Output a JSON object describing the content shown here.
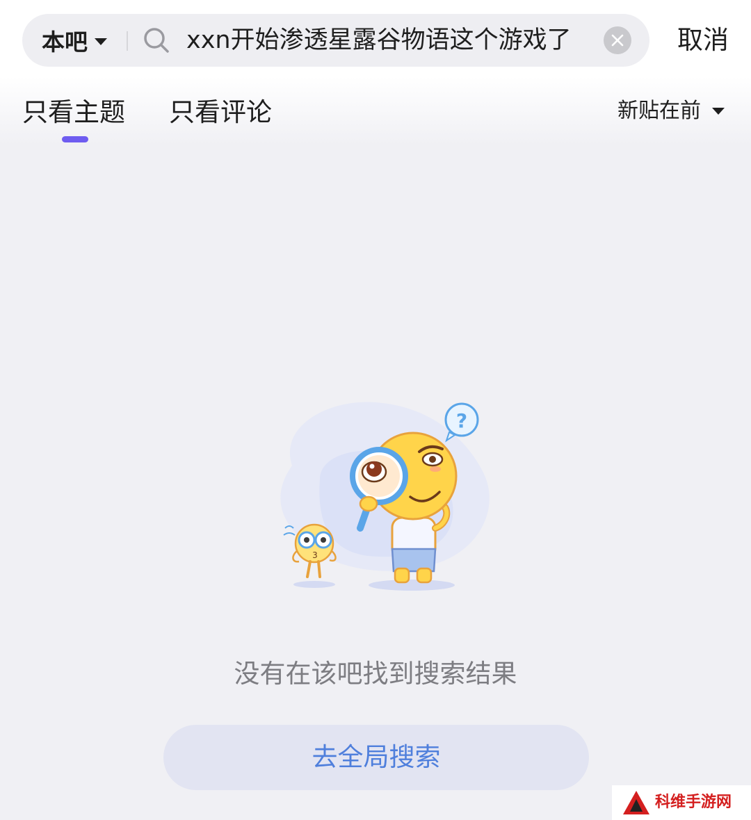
{
  "search": {
    "scope_label": "本吧",
    "query": "xxn开始渗透星露谷物语这个游戏了",
    "cancel_label": "取消"
  },
  "tabs": [
    {
      "label": "只看主题",
      "active": true
    },
    {
      "label": "只看评论",
      "active": false
    }
  ],
  "sort": {
    "label": "新贴在前"
  },
  "empty_state": {
    "message": "没有在该吧找到搜索结果",
    "button_label": "去全局搜索",
    "illustration": "magnifier-mascot-illustration"
  },
  "watermark": {
    "text": "科维手游网"
  },
  "colors": {
    "accent": "#6e5cf0",
    "link": "#4f7fdc",
    "background": "#f0f0f4"
  }
}
